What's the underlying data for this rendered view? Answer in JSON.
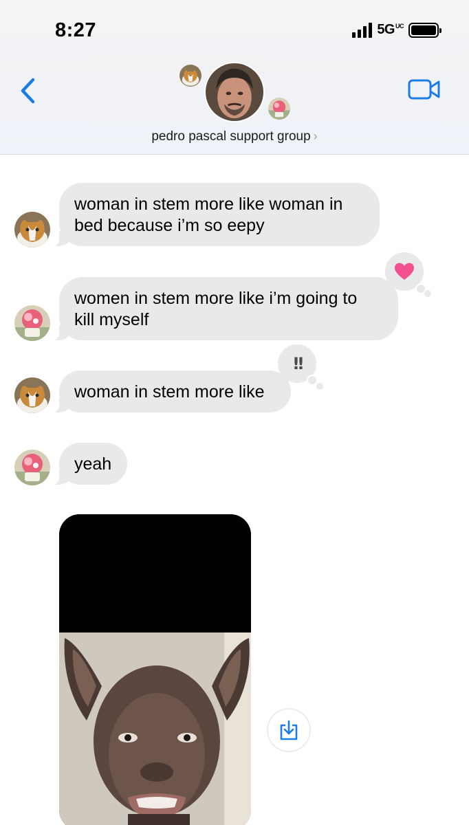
{
  "status_bar": {
    "time": "8:27",
    "network": "5G",
    "network_suffix": "UC"
  },
  "header": {
    "group_name": "pedro pascal support group",
    "back_icon": "chevron-left-icon",
    "video_icon": "video-camera-icon",
    "accent_color": "#1a7de6"
  },
  "messages": [
    {
      "text": "woman in stem more like woman in bed because i’m so eepy",
      "sender": "cat"
    },
    {
      "text": "women in stem more like i’m going to kill myself",
      "sender": "pink-character",
      "reaction": "heart"
    },
    {
      "text": "woman in stem more like",
      "sender": "cat",
      "reaction": "exclamation"
    },
    {
      "text": "yeah",
      "sender": "pink-character"
    }
  ],
  "reactions": {
    "heart_color": "#f2508f",
    "exclamation_label": "!!"
  },
  "attachment": {
    "type": "image",
    "save_icon": "download-icon"
  },
  "colors": {
    "bubble": "#e9e9eb",
    "background": "#ffffff"
  }
}
